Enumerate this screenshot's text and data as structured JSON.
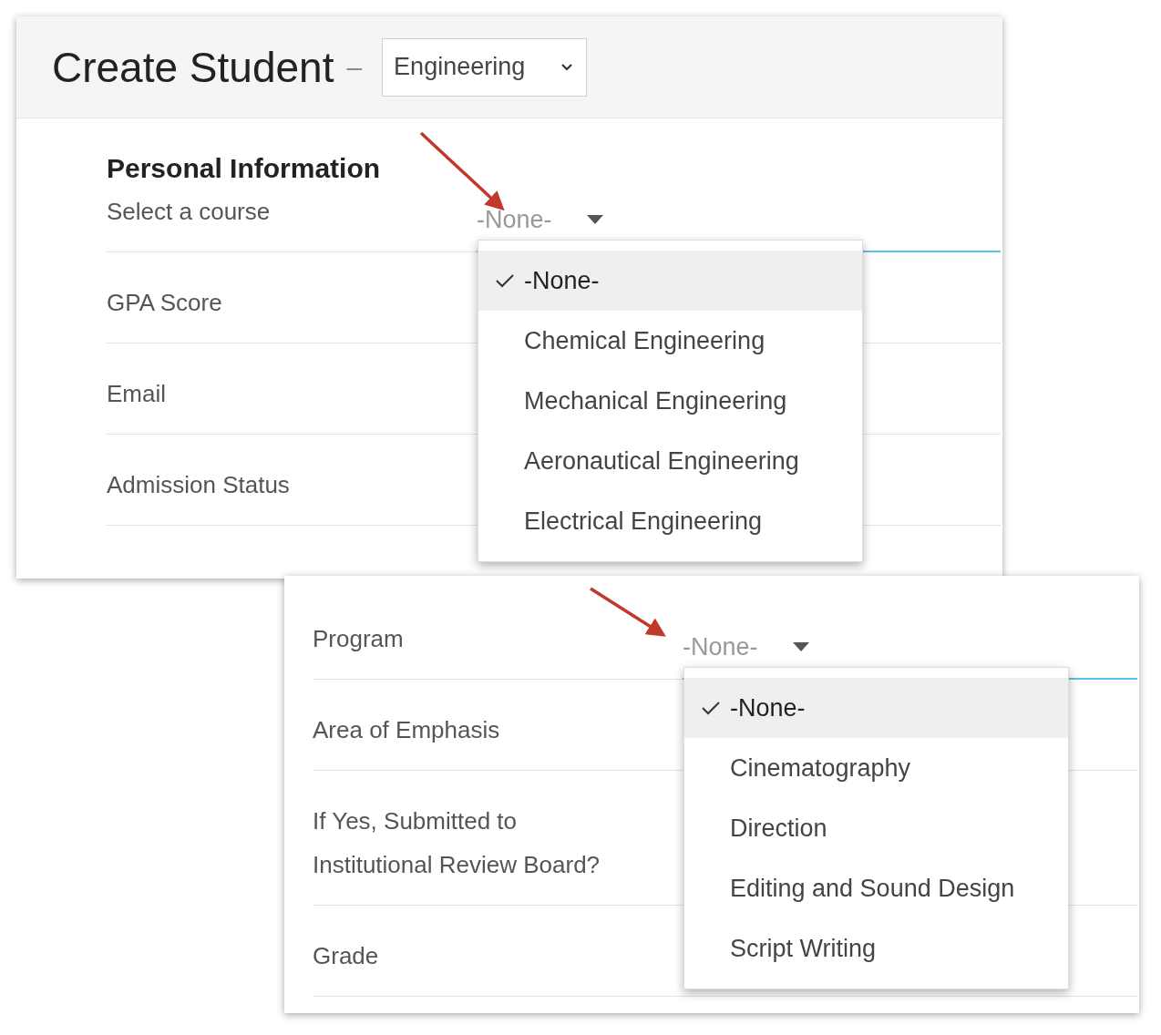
{
  "forms": [
    {
      "title": "Create Student",
      "separator": "–",
      "layout_select": "Engineering",
      "section": "Personal Information",
      "fields": [
        {
          "label": "Select a course",
          "value": "-None-",
          "focused": true,
          "expanded": true,
          "options": [
            {
              "label": "-None-",
              "selected": true
            },
            {
              "label": "Chemical Engineering",
              "selected": false
            },
            {
              "label": "Mechanical Engineering",
              "selected": false
            },
            {
              "label": "Aeronautical Engineering",
              "selected": false
            },
            {
              "label": "Electrical Engineering",
              "selected": false
            }
          ]
        },
        {
          "label": "GPA Score"
        },
        {
          "label": "Email"
        },
        {
          "label": "Admission Status"
        }
      ]
    },
    {
      "fields": [
        {
          "label": "Program",
          "value": "-None-",
          "focused": true,
          "expanded": true,
          "options": [
            {
              "label": "-None-",
              "selected": true
            },
            {
              "label": "Cinematography",
              "selected": false
            },
            {
              "label": "Direction",
              "selected": false
            },
            {
              "label": "Editing and Sound Design",
              "selected": false
            },
            {
              "label": "Script Writing",
              "selected": false
            }
          ]
        },
        {
          "label": "Area of Emphasis"
        },
        {
          "label": "If Yes, Submitted to Institutional Review Board?"
        },
        {
          "label": "Grade"
        }
      ]
    }
  ]
}
